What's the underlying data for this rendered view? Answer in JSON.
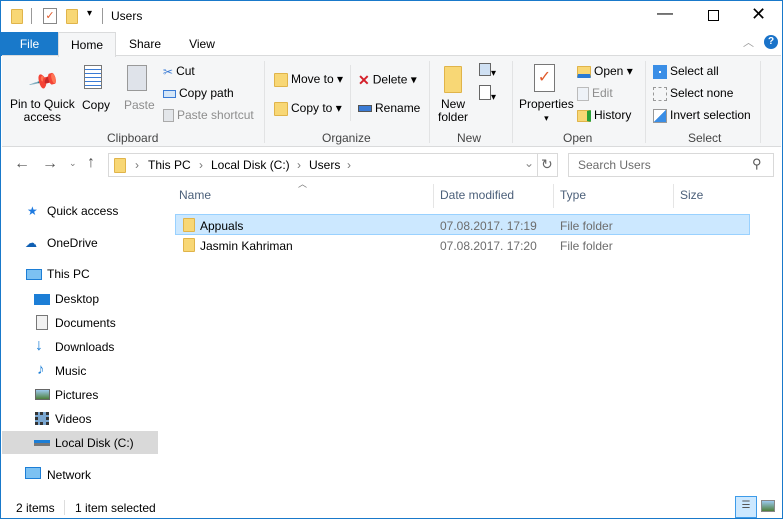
{
  "title": "Users",
  "tabs": {
    "file": "File",
    "home": "Home",
    "share": "Share",
    "view": "View"
  },
  "ribbon": {
    "clipboard": {
      "label": "Clipboard",
      "pin": "Pin to Quick access",
      "pin1": "Pin to Quick",
      "pin2": "access",
      "copy": "Copy",
      "paste": "Paste",
      "cut": "Cut",
      "copy_path": "Copy path",
      "paste_shortcut": "Paste shortcut"
    },
    "organize": {
      "label": "Organize",
      "move_to": "Move to",
      "copy_to": "Copy to",
      "delete": "Delete",
      "rename": "Rename"
    },
    "new": {
      "label": "New",
      "new_folder1": "New",
      "new_folder2": "folder"
    },
    "open": {
      "label": "Open",
      "properties": "Properties",
      "open": "Open",
      "edit": "Edit",
      "history": "History"
    },
    "select": {
      "label": "Select",
      "select_all": "Select all",
      "select_none": "Select none",
      "invert": "Invert selection"
    }
  },
  "address": {
    "crumbs": [
      "This PC",
      "Local Disk (C:)",
      "Users"
    ],
    "search_placeholder": "Search Users"
  },
  "nav": [
    {
      "label": "Quick access",
      "icon": "star-icon"
    },
    {
      "label": "OneDrive",
      "icon": "cloud-icon"
    },
    {
      "label": "This PC",
      "icon": "computer-icon"
    },
    {
      "label": "Desktop",
      "icon": "desktop-icon"
    },
    {
      "label": "Documents",
      "icon": "documents-icon"
    },
    {
      "label": "Downloads",
      "icon": "download-icon"
    },
    {
      "label": "Music",
      "icon": "music-icon"
    },
    {
      "label": "Pictures",
      "icon": "pictures-icon"
    },
    {
      "label": "Videos",
      "icon": "videos-icon"
    },
    {
      "label": "Local Disk (C:)",
      "icon": "drive-icon"
    },
    {
      "label": "Network",
      "icon": "network-icon"
    }
  ],
  "columns": [
    "Name",
    "Date modified",
    "Type",
    "Size"
  ],
  "files": [
    {
      "name": "Appuals",
      "date": "07.08.2017. 17:19",
      "type": "File folder",
      "size": ""
    },
    {
      "name": "Jasmin Kahriman",
      "date": "07.08.2017. 17:20",
      "type": "File folder",
      "size": ""
    }
  ],
  "status": {
    "count": "2 items",
    "selected": "1 item selected"
  },
  "colors": {
    "accent": "#1979ca",
    "selection": "#cce8ff"
  }
}
